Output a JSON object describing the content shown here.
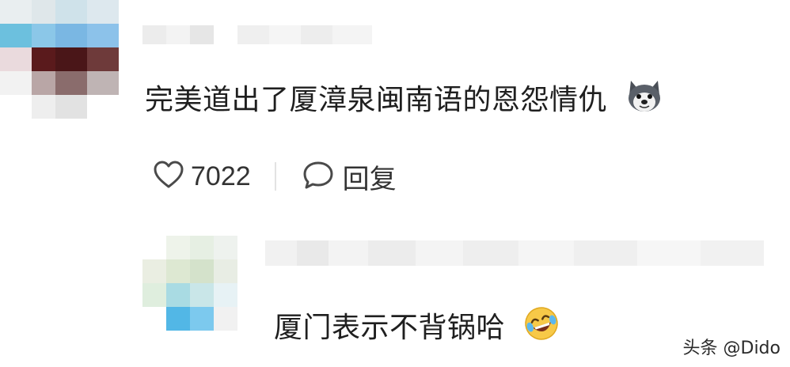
{
  "comments": [
    {
      "text": "完美道出了厦漳泉闽南语的恩怨情仇",
      "emoji_icon": "husky-dog-emoji-icon",
      "likes": "7022",
      "reply_label": "回复"
    },
    {
      "text": "厦门表示不背锅哈",
      "emoji_icon": "laughing-tears-emoji-icon"
    }
  ],
  "watermark": "头条 @Dido",
  "colors": {
    "text": "#1f1f1f",
    "action_text": "#333333",
    "divider": "#e3e3e3",
    "emoji_yellow": "#f7c948"
  }
}
